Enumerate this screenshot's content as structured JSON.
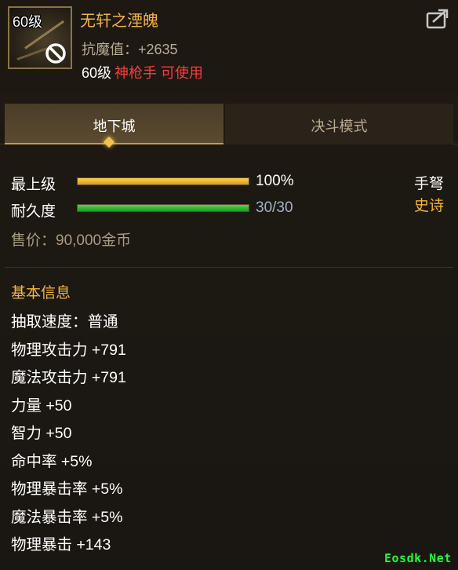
{
  "item": {
    "level_badge": "60级",
    "name": "无轩之湮魄",
    "stat_line": "抗魔值：+2635",
    "req_level": "60级",
    "req_class": "神枪手 可使用"
  },
  "tabs": [
    {
      "label": "地下城",
      "active": true
    },
    {
      "label": "决斗模式",
      "active": false
    }
  ],
  "bars": {
    "quality": {
      "label": "最上级",
      "value_text": "100%",
      "fill": 1.0,
      "color": "#f2b53d"
    },
    "durability": {
      "label": "耐久度",
      "value_text": "30/30",
      "fill": 1.0,
      "color": "#3ccf3c"
    }
  },
  "type": {
    "weapon": "手弩",
    "rarity": "史诗"
  },
  "price": "售价：90,000金币",
  "section": {
    "title": "基本信息",
    "attributes": [
      "抽取速度：普通",
      "物理攻击力 +791",
      "魔法攻击力 +791",
      "力量 +50",
      "智力 +50",
      "命中率 +5%",
      "物理暴击率 +5%",
      "魔法暴击率 +5%",
      "物理暴击 +143"
    ]
  },
  "watermark": "Eosdk.Net",
  "icons": [
    "no-entry-icon",
    "share-icon",
    "tab-indicator-icon"
  ],
  "colors": {
    "gold": "#f2b53d",
    "red": "#ff3b3b",
    "green": "#3ccf3c",
    "blue_value": "#9fb3c9"
  }
}
